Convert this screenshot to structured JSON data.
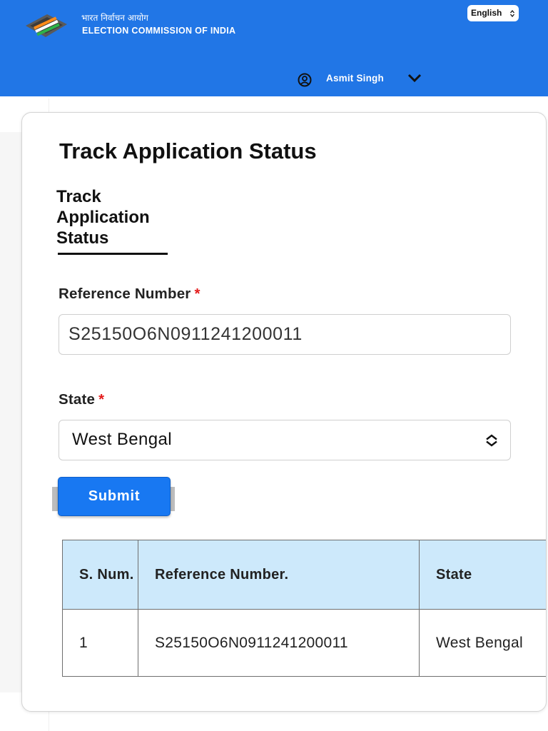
{
  "header": {
    "org_name_hindi": "भारत निर्वाचन आयोग",
    "org_name_english": "ELECTION COMMISSION OF INDIA",
    "language_selected": "English",
    "user_name": "Asmit Singh"
  },
  "page": {
    "title": "Track Application Status",
    "tab_label": "Track Application Status"
  },
  "form": {
    "reference_label": "Reference Number",
    "reference_value": "S25150O6N0911241200011",
    "state_label": "State",
    "state_value": "West Bengal",
    "required_marker": "*",
    "submit_label": "Submit"
  },
  "results": {
    "columns": [
      "S. Num.",
      "Reference Number.",
      "State"
    ],
    "rows": [
      [
        "1",
        "S25150O6N0911241200011",
        "West Bengal"
      ]
    ]
  },
  "colors": {
    "header_bg": "#2176e6",
    "button_bg": "#1878f2",
    "table_header_bg": "#cde9fb",
    "required": "#e31b1b"
  },
  "icons": [
    "eci-logo-icon",
    "up-down-icon",
    "user-circle-icon",
    "chevron-down-icon"
  ]
}
